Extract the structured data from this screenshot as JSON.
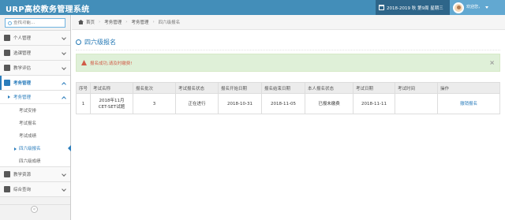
{
  "app": {
    "title": "URP高校教务管理系统"
  },
  "topbar": {
    "term": "2018-2019 秋 第9周 星期三",
    "welcome": "欢迎您，",
    "user_name": ""
  },
  "sidebar": {
    "search_placeholder": "查找功能...",
    "items": [
      {
        "label": "个人管理"
      },
      {
        "label": "选课管理"
      },
      {
        "label": "教学评估"
      },
      {
        "label": "考务管理"
      }
    ],
    "sub_parent": "考务管理",
    "leaves": [
      {
        "label": "考试安排"
      },
      {
        "label": "考试报名"
      },
      {
        "label": "考试成绩"
      },
      {
        "label": "四六级报名"
      },
      {
        "label": "四六级成绩"
      }
    ],
    "bottom_items": [
      {
        "label": "教学资源"
      },
      {
        "label": "综合查询"
      }
    ],
    "collapse_glyph": "«"
  },
  "breadcrumb": {
    "home": "首页",
    "level1": "考务管理",
    "level2": "考务管理",
    "current": "四六级报名"
  },
  "page": {
    "title": "四六级报名"
  },
  "alert": {
    "message": "报名成功,请及时缴费!",
    "close": "×"
  },
  "table": {
    "headers": [
      "序号",
      "考试名称",
      "报名批次",
      "考试报名状态",
      "报名开始日期",
      "报名结束日期",
      "本人报名状态",
      "考试日期",
      "考试时间",
      "操作"
    ],
    "rows": [
      {
        "index": "1",
        "name_line1": "2018年11月",
        "name_line2": "CET-SET试题",
        "batch": "3",
        "exam_status": "正在进行",
        "start": "2018-10-31",
        "end": "2018-11-05",
        "my_status": "已报未缴费",
        "exam_date": "2018-11-11",
        "exam_time": "",
        "action": "撤销报名"
      }
    ]
  }
}
